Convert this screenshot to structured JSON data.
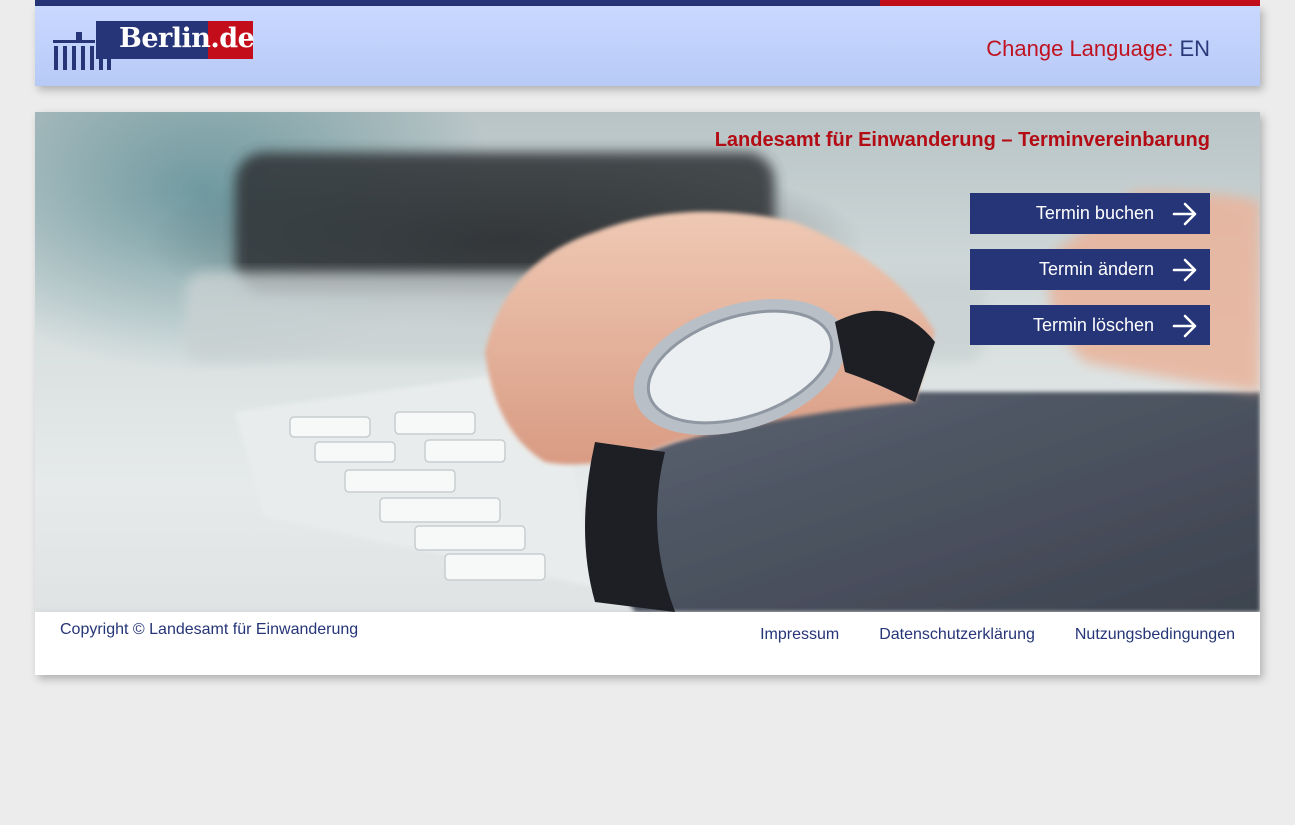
{
  "colors": {
    "brand_blue": "#253577",
    "brand_red": "#c0121f",
    "header_bg": "#c9d8ff",
    "page_bg": "#ececec"
  },
  "header": {
    "logo": {
      "text": "Berlin.de",
      "icon": "brandenburg-gate-logo-icon"
    },
    "language_label": "Change Language:",
    "language_value": "EN"
  },
  "hero": {
    "title": "Landesamt für Einwanderung – Terminvereinbarung",
    "buttons": [
      {
        "label": "Termin buchen",
        "icon": "arrow-right-icon"
      },
      {
        "label": "Termin ändern",
        "icon": "arrow-right-icon"
      },
      {
        "label": "Termin löschen",
        "icon": "arrow-right-icon"
      }
    ]
  },
  "footer": {
    "copyright": "Copyright © Landesamt für Einwanderung",
    "links": [
      "Impressum",
      "Datenschutzerklärung",
      "Nutzungsbedingungen"
    ]
  }
}
